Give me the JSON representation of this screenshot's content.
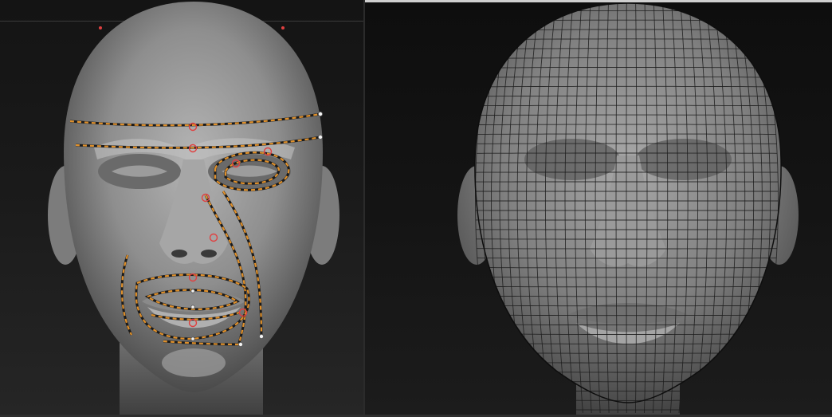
{
  "colors": {
    "background": "#121212",
    "clay": "#9a9a9a",
    "mesh": "#1c1c1c",
    "guide_curve": "#e0902a",
    "curve_handle": "#e04040",
    "top_bar": "#cfcfcf"
  },
  "viewports": [
    {
      "name": "sculpt-reference",
      "icon": "head-sculpt-icon"
    },
    {
      "name": "retopology-mesh",
      "icon": "head-wireframe-icon"
    }
  ]
}
